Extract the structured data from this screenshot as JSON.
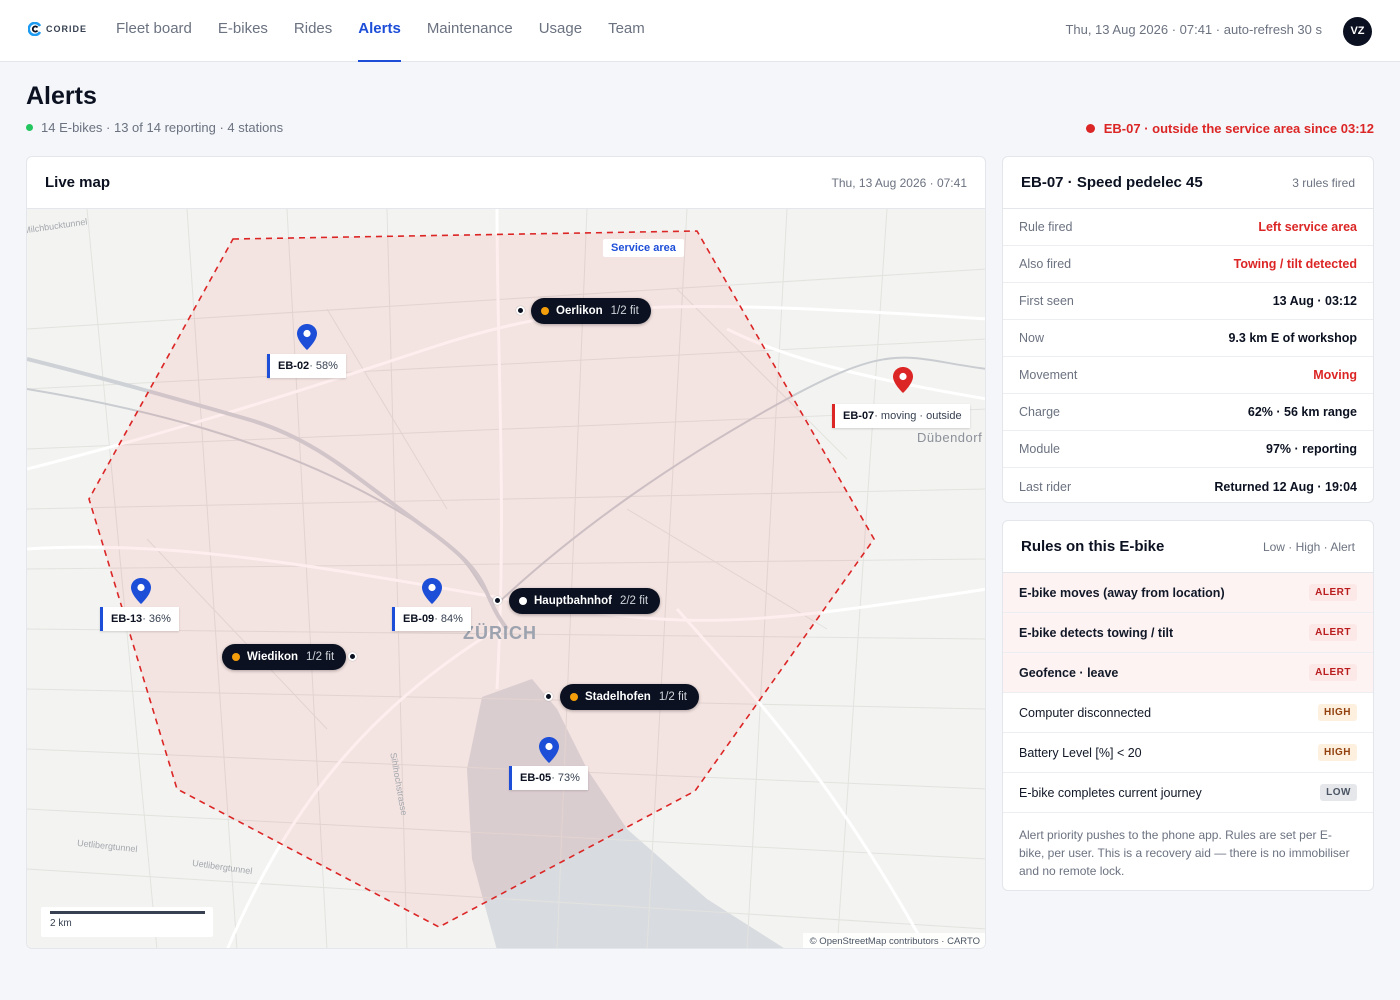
{
  "brand": {
    "name": "CORIDE"
  },
  "nav": {
    "items": [
      {
        "label": "Fleet board",
        "active": false
      },
      {
        "label": "E-bikes",
        "active": false
      },
      {
        "label": "Rides",
        "active": false
      },
      {
        "label": "Alerts",
        "active": true
      },
      {
        "label": "Maintenance",
        "active": false
      },
      {
        "label": "Usage",
        "active": false
      },
      {
        "label": "Team",
        "active": false
      }
    ]
  },
  "header": {
    "datetime": "Thu, 13 Aug 2026 · 07:41 · auto-refresh 30 s",
    "avatar": "VZ"
  },
  "page": {
    "title": "Alerts",
    "summary": "14 E-bikes · 13 of 14 reporting · 4 stations",
    "alert_banner": "EB-07 · outside the service area since 03:12"
  },
  "map": {
    "title": "Live map",
    "timestamp": "Thu, 13 Aug 2026 · 07:41",
    "service_area_label": "Service area",
    "stations": [
      {
        "name": "Oerlikon",
        "fit": "1/2 fit",
        "dot_color": "#f59e0b"
      },
      {
        "name": "Hauptbahnhof",
        "fit": "2/2 fit",
        "dot_color": "#ffffff"
      },
      {
        "name": "Wiedikon",
        "fit": "1/2 fit",
        "dot_color": "#f59e0b"
      },
      {
        "name": "Stadelhofen",
        "fit": "1/2 fit",
        "dot_color": "#f59e0b"
      }
    ],
    "bikes": [
      {
        "id": "EB-02",
        "detail": " · 58%",
        "status_color": "#1d4ed8"
      },
      {
        "id": "EB-07",
        "detail": " · moving · outside",
        "status_color": "#dc2626"
      },
      {
        "id": "EB-13",
        "detail": " · 36%",
        "status_color": "#1d4ed8"
      },
      {
        "id": "EB-09",
        "detail": " · 84%",
        "status_color": "#1d4ed8"
      },
      {
        "id": "EB-05",
        "detail": " · 73%",
        "status_color": "#1d4ed8"
      }
    ],
    "city_label": "ZÜRICH",
    "town_label": "Dübendorf",
    "road_labels": [
      "Milchbucktunnel",
      "Uetlibergtunnel",
      "Uetlibergtunnel",
      "Sihlhochstrasse"
    ],
    "scale": "2 km",
    "attribution": "© OpenStreetMap contributors · CARTO"
  },
  "detail": {
    "title": "EB-07 · Speed pedelec 45",
    "meta": "3 rules fired",
    "rows": [
      {
        "label": "Rule fired",
        "value": "Left service area",
        "highlight": true
      },
      {
        "label": "Also fired",
        "value": "Towing / tilt detected",
        "highlight": true
      },
      {
        "label": "First seen",
        "value": "13 Aug · 03:12",
        "highlight": false
      },
      {
        "label": "Now",
        "value": "9.3 km E of workshop",
        "highlight": false
      },
      {
        "label": "Movement",
        "value": "Moving",
        "highlight": true
      },
      {
        "label": "Charge",
        "value": "62% · 56 km range",
        "highlight": false
      },
      {
        "label": "Module",
        "value": "97% · reporting",
        "highlight": false
      },
      {
        "label": "Last rider",
        "value": "Returned 12 Aug · 19:04",
        "highlight": false
      }
    ]
  },
  "rules": {
    "title": "Rules on this E-bike",
    "legend": "Low · High · Alert",
    "items": [
      {
        "label": "E-bike moves (away from location)",
        "level": "ALERT"
      },
      {
        "label": "E-bike detects towing / tilt",
        "level": "ALERT"
      },
      {
        "label": "Geofence · leave",
        "level": "ALERT"
      },
      {
        "label": "Computer disconnected",
        "level": "HIGH"
      },
      {
        "label": "Battery Level [%] < 20",
        "level": "HIGH"
      },
      {
        "label": "E-bike completes current journey",
        "level": "LOW"
      }
    ],
    "note": "Alert priority pushes to the phone app. Rules are set per E-bike, per user. This is a recovery aid — there is no immobiliser and no remote lock."
  }
}
